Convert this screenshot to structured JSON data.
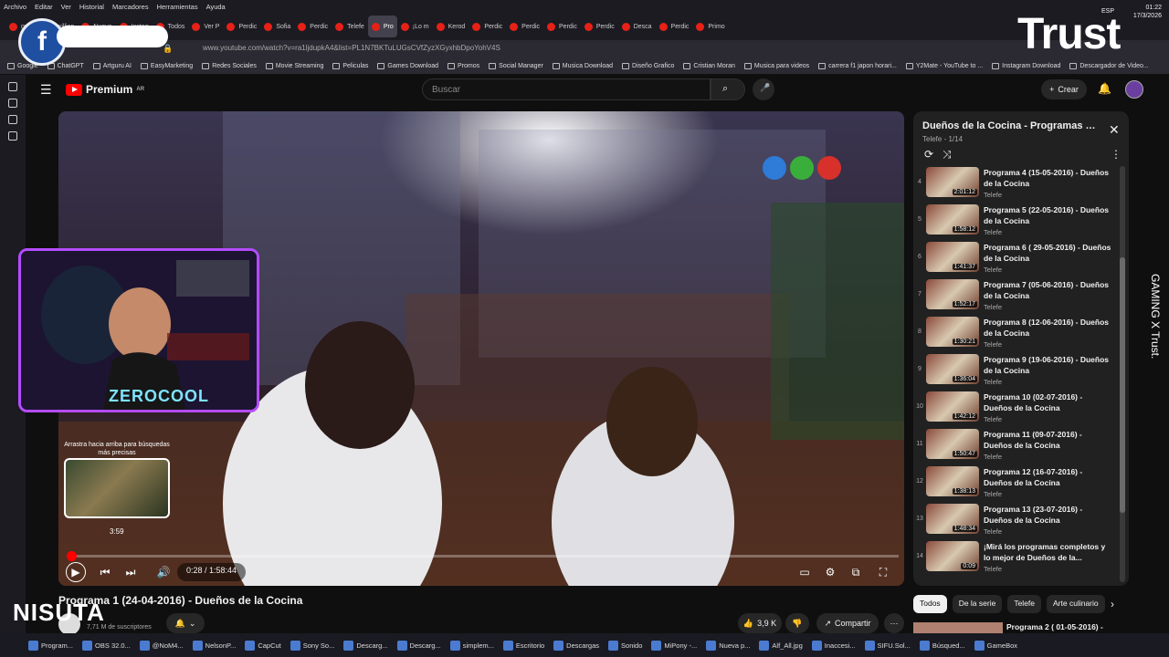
{
  "menu": [
    "Archivo",
    "Editar",
    "Ver",
    "Historial",
    "Marcadores",
    "Herramientas",
    "Ayuda"
  ],
  "tabs": [
    "guiley",
    "willian",
    "Nueva",
    "Instag",
    "Todos",
    "Ver P",
    "Perdic",
    "Sofia",
    "Perdic",
    "Telefe",
    "Pro",
    "¡Lo m",
    "Kerod",
    "Perdic",
    "Perdic",
    "Perdic",
    "Perdic",
    "Desca",
    "Perdic",
    "Primo"
  ],
  "active_tab_index": 10,
  "url": "www.youtube.com/watch?v=ra1ljdupkA4&list=PL1N7BKTuLUGsCVfZyzXGyxhbDpoYohV4S",
  "bookmarks": [
    "Google",
    "ChatGPT",
    "Artguru AI",
    "EasyMarketing",
    "Redes Sociales",
    "Movie Streaming",
    "Peliculas",
    "Games Download",
    "Promos",
    "Social Manager",
    "Musica Download",
    "Diseño Grafico",
    "Cristian Moran",
    "Musica para videos",
    "carrera f1 japon horari...",
    "Y2Mate - YouTube to ...",
    "Instagram Download",
    "Descargador de Video..."
  ],
  "yt": {
    "logo": "Premium",
    "region": "AR",
    "search_placeholder": "Buscar",
    "create": "Crear"
  },
  "player": {
    "time": "0:28 / 1:58:44",
    "progress": 0.004,
    "preview_time": "3:59",
    "preview_hint": "Arrastra hacia arriba para búsquedas más precisas"
  },
  "webcam": {
    "label": "ZEROCOOL"
  },
  "playlist": {
    "title": "Dueños de la Cocina - Programas co...",
    "channel": "Telefe",
    "position": "1/14",
    "items": [
      {
        "n": "4",
        "title": "Programa 4 (15-05-2016) - Dueños de la Cocina",
        "dur": "2:01:12",
        "ch": "Telefe"
      },
      {
        "n": "5",
        "title": "Programa 5 (22-05-2016) - Dueños de la Cocina",
        "dur": "1:58:12",
        "ch": "Telefe"
      },
      {
        "n": "6",
        "title": "Programa 6 ( 29-05-2016) - Dueños de la Cocina",
        "dur": "1:41:37",
        "ch": "Telefe"
      },
      {
        "n": "7",
        "title": "Programa 7 (05-06-2016) - Dueños de la Cocina",
        "dur": "1:52:17",
        "ch": "Telefe"
      },
      {
        "n": "8",
        "title": "Programa 8 (12-06-2016) - Dueños de la Cocina",
        "dur": "1:30:21",
        "ch": "Telefe"
      },
      {
        "n": "9",
        "title": "Programa 9 (19-06-2016) - Dueños de la Cocina",
        "dur": "1:36:04",
        "ch": "Telefe"
      },
      {
        "n": "10",
        "title": "Programa 10 (02-07-2016) - Dueños de la Cocina",
        "dur": "1:42:12",
        "ch": "Telefe"
      },
      {
        "n": "11",
        "title": "Programa 11 (09-07-2016) - Dueños de la Cocina",
        "dur": "1:50:47",
        "ch": "Telefe"
      },
      {
        "n": "12",
        "title": "Programa 12 (16-07-2016) - Dueños de la Cocina",
        "dur": "1:38:13",
        "ch": "Telefe"
      },
      {
        "n": "13",
        "title": "Programa 13 (23-07-2016) - Dueños de la Cocina",
        "dur": "1:48:34",
        "ch": "Telefe"
      },
      {
        "n": "14",
        "title": "¡Mirá los programas completos y lo mejor de Dueños de la...",
        "dur": "0:09",
        "ch": "Telefe"
      }
    ]
  },
  "chips": [
    "Todos",
    "De la serie",
    "Telefe",
    "Arte culinario"
  ],
  "video": {
    "title": "Programa 1 (24-04-2016) - Dueños de la Cocina",
    "subs": "7,71 M de suscriptores",
    "likes": "3,9 K",
    "share": "Compartir"
  },
  "next_up": "Programa 2 ( 01-05-2016) -",
  "taskbar": [
    "Program...",
    "OBS 32.0...",
    "@NoM4...",
    "NelsonP...",
    "CapCut",
    "Sony So...",
    "Descarg...",
    "Descarg...",
    "simplem...",
    "Escritorio",
    "Descargas",
    "Sonido",
    "MiPony -...",
    "Nueva p...",
    "Alf_All.jpg",
    "Inaccesi...",
    "SIFU.Sol...",
    "Búsqued...",
    "GameBox"
  ],
  "tray": {
    "lang": "ESP",
    "time": "01:22",
    "date": "17/3/2026"
  },
  "overlays": {
    "trust": "Trust",
    "trust_vertical": "GAMING X Trust.",
    "nisuta": "NISUTA",
    "f_badge": "f"
  }
}
